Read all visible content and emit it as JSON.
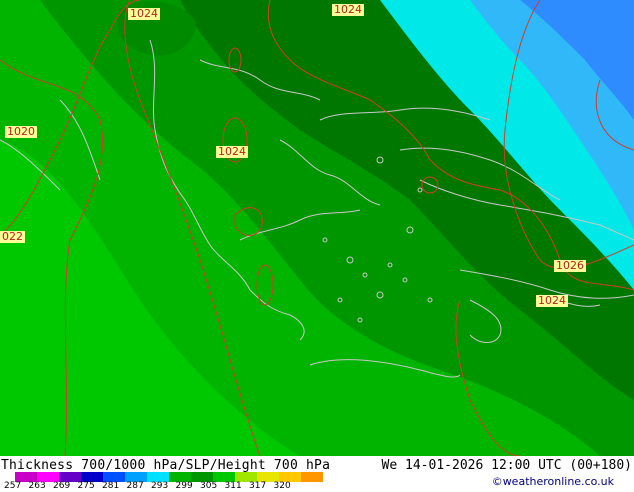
{
  "map": {
    "isobar_labels": [
      {
        "id": "label-1024-nw",
        "text": "1024"
      },
      {
        "id": "label-1024-ne",
        "text": "1024"
      },
      {
        "id": "label-1020-w",
        "text": "1020"
      },
      {
        "id": "label-1024-center",
        "text": "1024"
      },
      {
        "id": "label-1022-w",
        "text": "022"
      },
      {
        "id": "label-1026-e",
        "text": "1026"
      },
      {
        "id": "label-1024-se",
        "text": "1024"
      }
    ],
    "colors": {
      "dark_green": "#007800",
      "mid_green": "#009600",
      "light_green": "#00b400",
      "bright_green": "#00c800",
      "cyan": "#00e8e8",
      "light_blue": "#30b8f8",
      "blue": "#2e8cff",
      "isobar": "#d23c28",
      "coastline": "#c8c8c8"
    }
  },
  "footer": {
    "title": "Thickness 700/1000 hPa/SLP/Height 700 hPa",
    "valid_time": "We 14-01-2026 12:00 UTC (00+180)",
    "credit": "©weatheronline.co.uk",
    "legend": {
      "ticks": [
        "257",
        "263",
        "269",
        "275",
        "281",
        "287",
        "293",
        "299",
        "305",
        "311",
        "317",
        "320"
      ],
      "colors": [
        "#c800c8",
        "#ff00ff",
        "#6400c8",
        "#0000c8",
        "#0050ff",
        "#00a0ff",
        "#00e0ff",
        "#00b400",
        "#009600",
        "#00c800",
        "#a0e600",
        "#e6e600",
        "#ffc800",
        "#ff9600"
      ]
    }
  }
}
